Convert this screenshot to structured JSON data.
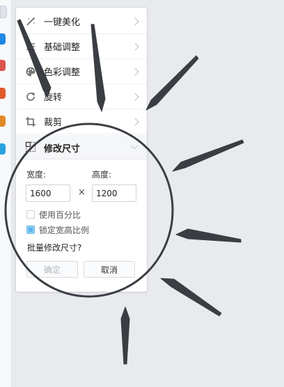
{
  "menu": {
    "items": [
      {
        "label": "一键美化",
        "icon": "magic-wand-icon"
      },
      {
        "label": "基础调整",
        "icon": "sliders-icon"
      },
      {
        "label": "色彩调整",
        "icon": "palette-icon"
      },
      {
        "label": "旋转",
        "icon": "rotate-icon"
      },
      {
        "label": "裁剪",
        "icon": "crop-icon"
      }
    ],
    "active_section": {
      "label": "修改尺寸",
      "icon": "resize-icon"
    }
  },
  "resize": {
    "width_label": "宽度:",
    "height_label": "高度:",
    "width_value": "1600",
    "height_value": "1200",
    "times_symbol": "×",
    "use_percent_label": "使用百分比",
    "use_percent_checked": false,
    "lock_ratio_label": "锁定宽高比例",
    "lock_ratio_checked": true,
    "batch_label": "批量修改尺寸?",
    "confirm_label": "确定",
    "cancel_label": "取消"
  },
  "colors": {
    "annotation": "#3a3d42",
    "checkbox_checked": "#8ccff3"
  }
}
